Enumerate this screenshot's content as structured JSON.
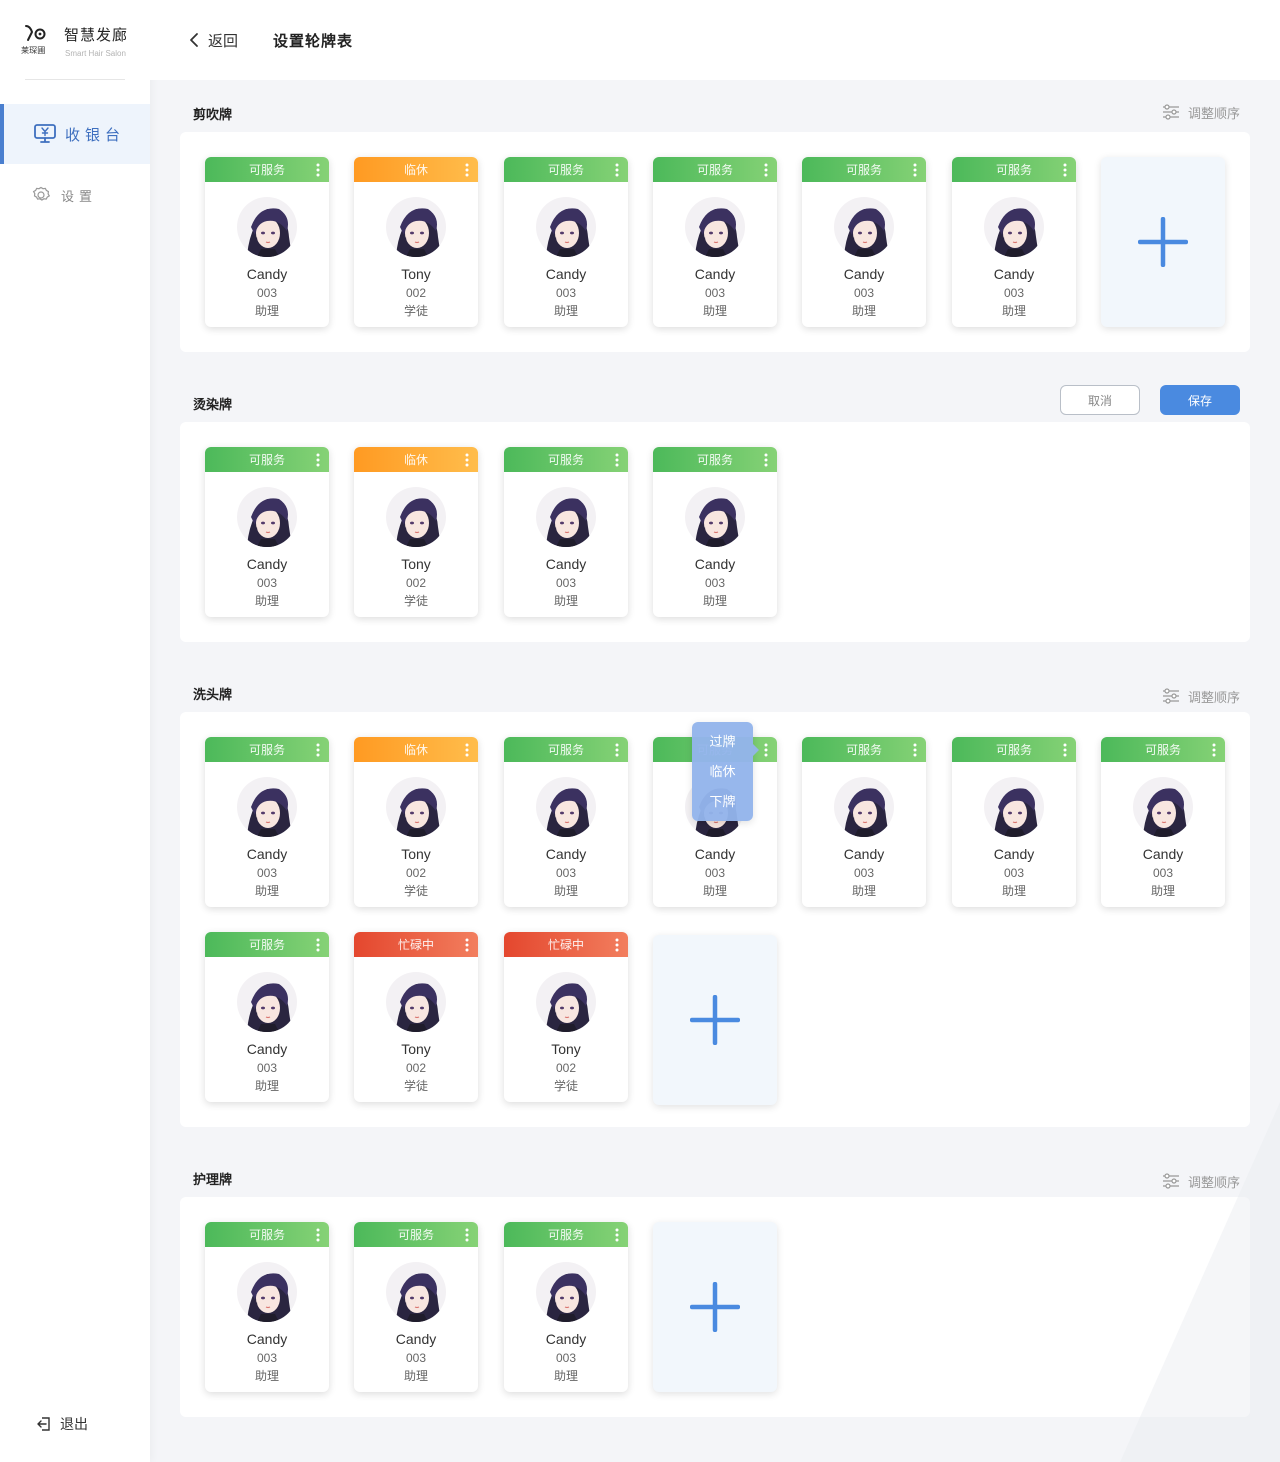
{
  "brand": {
    "logo_text": "莱琛圃",
    "title": "智慧发廊",
    "subtitle": "Smart Hair Salon"
  },
  "sidebar": {
    "items": [
      {
        "label": "收银台",
        "icon": "cashier-icon",
        "active": true
      },
      {
        "label": "设置",
        "icon": "gear-icon",
        "active": false
      }
    ],
    "logout_label": "退出"
  },
  "header": {
    "back_label": "返回",
    "title": "设置轮牌表"
  },
  "colors": {
    "accent": "#4a8ae0",
    "available": "#4cb95a",
    "break": "#ff9a22",
    "busy": "#e4472e",
    "add_bg": "#f2f7fc"
  },
  "sections": [
    {
      "title": "剪吹牌",
      "adjust_label": "调整顺序",
      "cards": [
        {
          "status": "可服务",
          "name": "Candy",
          "id": "003",
          "role": "助理"
        },
        {
          "status": "临休",
          "name": "Tony",
          "id": "002",
          "role": "学徒"
        },
        {
          "status": "可服务",
          "name": "Candy",
          "id": "003",
          "role": "助理"
        },
        {
          "status": "可服务",
          "name": "Candy",
          "id": "003",
          "role": "助理"
        },
        {
          "status": "可服务",
          "name": "Candy",
          "id": "003",
          "role": "助理"
        },
        {
          "status": "可服务",
          "name": "Candy",
          "id": "003",
          "role": "助理"
        }
      ]
    },
    {
      "title": "烫染牌",
      "cancel_label": "取消",
      "save_label": "保存",
      "cards": [
        {
          "status": "可服务",
          "name": "Candy",
          "id": "003",
          "role": "助理"
        },
        {
          "status": "临休",
          "name": "Tony",
          "id": "002",
          "role": "学徒"
        },
        {
          "status": "可服务",
          "name": "Candy",
          "id": "003",
          "role": "助理"
        },
        {
          "status": "可服务",
          "name": "Candy",
          "id": "003",
          "role": "助理"
        }
      ]
    },
    {
      "title": "洗头牌",
      "adjust_label": "调整顺序",
      "cards": [
        {
          "status": "可服务",
          "name": "Candy",
          "id": "003",
          "role": "助理"
        },
        {
          "status": "临休",
          "name": "Tony",
          "id": "002",
          "role": "学徒"
        },
        {
          "status": "可服务",
          "name": "Candy",
          "id": "003",
          "role": "助理"
        },
        {
          "status": "可服务",
          "name": "Candy",
          "id": "003",
          "role": "助理"
        },
        {
          "status": "可服务",
          "name": "Candy",
          "id": "003",
          "role": "助理"
        },
        {
          "status": "可服务",
          "name": "Candy",
          "id": "003",
          "role": "助理"
        },
        {
          "status": "可服务",
          "name": "Candy",
          "id": "003",
          "role": "助理"
        },
        {
          "status": "可服务",
          "name": "Candy",
          "id": "003",
          "role": "助理"
        },
        {
          "status": "忙碌中",
          "name": "Tony",
          "id": "002",
          "role": "学徒"
        },
        {
          "status": "忙碌中",
          "name": "Tony",
          "id": "002",
          "role": "学徒"
        }
      ],
      "popup_menu": [
        "过牌",
        "临休",
        "下牌"
      ]
    },
    {
      "title": "护理牌",
      "adjust_label": "调整顺序",
      "cards": [
        {
          "status": "可服务",
          "name": "Candy",
          "id": "003",
          "role": "助理"
        },
        {
          "status": "可服务",
          "name": "Candy",
          "id": "003",
          "role": "助理"
        },
        {
          "status": "可服务",
          "name": "Candy",
          "id": "003",
          "role": "助理"
        }
      ]
    }
  ]
}
